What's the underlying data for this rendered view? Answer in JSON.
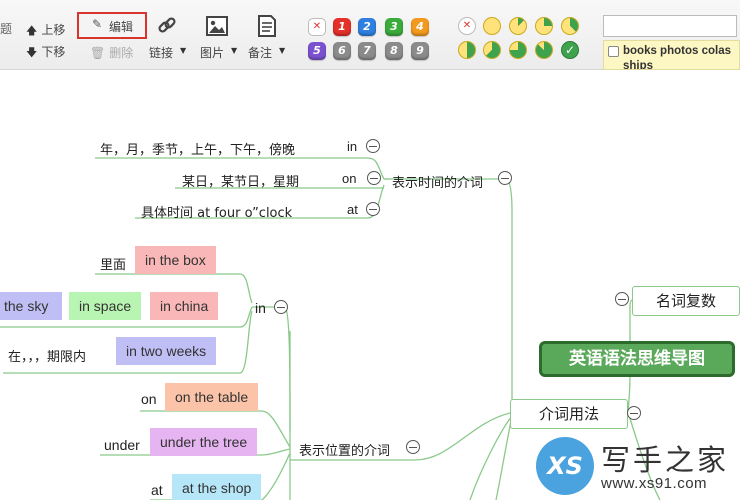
{
  "toolbar": {
    "partial_left": "题",
    "move_up": "上移",
    "move_down": "下移",
    "edit": "编辑",
    "delete": "删除",
    "link": "链接",
    "image": "图片",
    "note": "备注",
    "priorities": [
      "✕",
      "1",
      "2",
      "3",
      "4",
      "5",
      "6",
      "7",
      "8",
      "9"
    ],
    "priority_colors": [
      "#ffffff",
      "#e5302a",
      "#2f7fe0",
      "#3bab3b",
      "#f39a1e",
      "#7a52cf",
      "#8b8b8b",
      "#8b8b8b",
      "#8b8b8b",
      "#8b8b8b"
    ],
    "progress_fractions": [
      0,
      0,
      0.125,
      0.25,
      0.375,
      0.5,
      0.625,
      0.75,
      0.875,
      1
    ],
    "progress_colors": {
      "fill": "#ffe27a",
      "done": "#3fa34d"
    },
    "search_value": "",
    "resource_text": "books photos colas ships"
  },
  "mindmap": {
    "root": "英语语法思维导图",
    "branch_right": "名词复数",
    "branch_left": "介词用法",
    "time_group": "表示时间的介词",
    "time_items": [
      {
        "text": "年，月，季节，上午，下午，傍晚",
        "prep": "in"
      },
      {
        "text": "某日，某节日，星期",
        "prep": "on"
      },
      {
        "text": "具体时间  at four o”clock",
        "prep": "at"
      }
    ],
    "place_group": "表示位置的介词",
    "place_in_prep": "in",
    "place_in_label_1": "里面",
    "place_in_tag_1": "in the box",
    "place_in_tags_2": [
      "the sky",
      "in space",
      "in china"
    ],
    "place_in_label_3": "在，，，期限内",
    "place_in_tag_3": "in two weeks",
    "place_on_prep": "on",
    "place_on_tag": "on the table",
    "place_under_prep": "under",
    "place_under_tag": "under the tree",
    "place_at_prep": "at",
    "place_at_tag": "at the shop",
    "colors": {
      "pink": "#f9b7b7",
      "blue": "#bfbff5",
      "green": "#b9f5b2",
      "salmon": "#fbc3a8",
      "violet": "#e6b4f1",
      "cyan": "#b6e7f8",
      "line": "#8ac98a"
    }
  },
  "watermark": {
    "logo": "XS",
    "title": "写手之家",
    "url": "www.xs91.com"
  }
}
